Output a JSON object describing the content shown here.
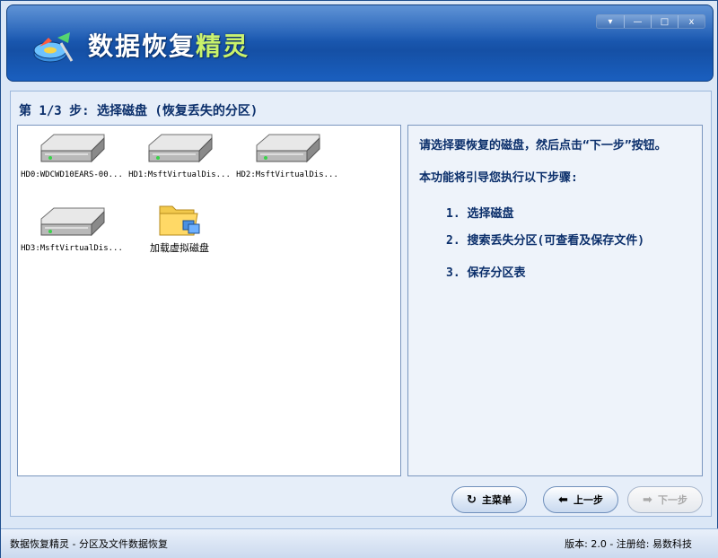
{
  "window": {
    "title_part1": "数据恢复",
    "title_part2": "精灵",
    "controls": [
      "▾",
      "—",
      "□",
      "x"
    ]
  },
  "step": {
    "title": "第 1/3 步: 选择磁盘 (恢复丢失的分区)"
  },
  "disks": [
    {
      "label": "HD0:WDCWD10EARS-00...",
      "icon": "hard-disk-icon"
    },
    {
      "label": "HD1:MsftVirtualDis...",
      "icon": "hard-disk-icon"
    },
    {
      "label": "HD2:MsftVirtualDis...",
      "icon": "hard-disk-icon"
    },
    {
      "label": "HD3:MsftVirtualDis...",
      "icon": "hard-disk-icon"
    },
    {
      "label": "加载虚拟磁盘",
      "icon": "folder-virtual-disk-icon"
    }
  ],
  "instructions": {
    "intro": "请选择要恢复的磁盘，然后点击“下一步”按钮。",
    "guide": "本功能将引导您执行以下步骤:",
    "steps": [
      "1. 选择磁盘",
      "2. 搜索丢失分区(可查看及保存文件)",
      "3. 保存分区表"
    ]
  },
  "buttons": {
    "main_menu": "主菜单",
    "prev": "上一步",
    "next": "下一步"
  },
  "statusbar": {
    "left": "数据恢复精灵 - 分区及文件数据恢复",
    "right": "版本: 2.0 - 注册给: 易数科技"
  },
  "colors": {
    "header": "#1c5bb4",
    "title_accent": "#c9f26b",
    "panel_text": "#0b2f6b"
  }
}
